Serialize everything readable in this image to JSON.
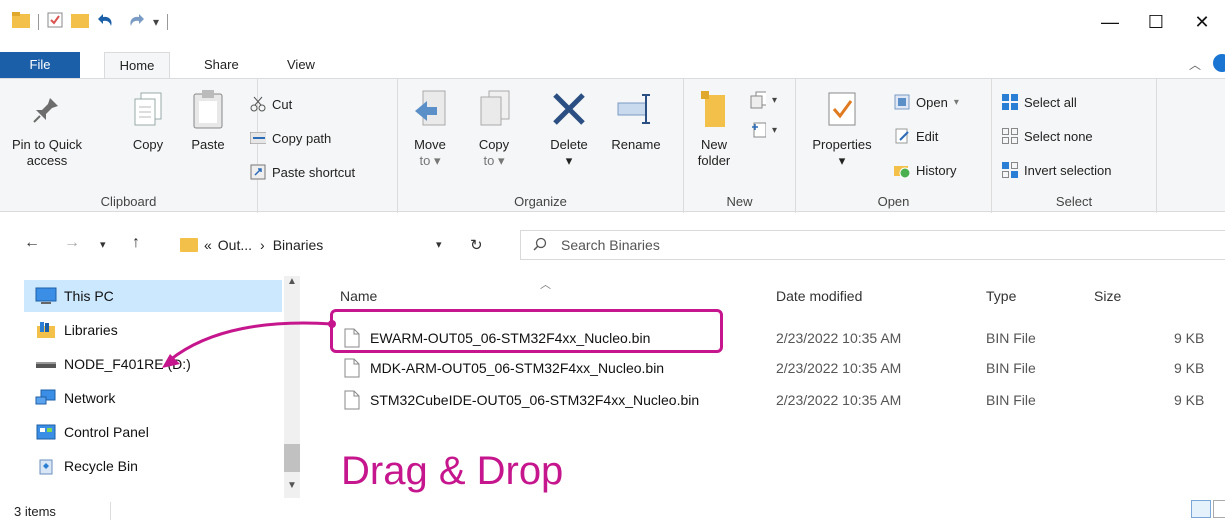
{
  "window": {
    "minimize": "—",
    "maximize": "☐",
    "close": "✕"
  },
  "tabs": {
    "file": "File",
    "home": "Home",
    "share": "Share",
    "view": "View"
  },
  "ribbon": {
    "clipboard": {
      "pin_line1": "Pin to Quick",
      "pin_line2": "access",
      "copy": "Copy",
      "paste": "Paste",
      "cut": "Cut",
      "copy_path": "Copy path",
      "paste_shortcut": "Paste shortcut",
      "label": "Clipboard"
    },
    "organize": {
      "move_line1": "Move",
      "move_line2": "to",
      "copy_line1": "Copy",
      "copy_line2": "to",
      "delete": "Delete",
      "rename": "Rename",
      "label": "Organize"
    },
    "new": {
      "new_folder_line1": "New",
      "new_folder_line2": "folder",
      "label": "New"
    },
    "open": {
      "properties": "Properties",
      "open": "Open",
      "edit": "Edit",
      "history": "History",
      "label": "Open"
    },
    "select": {
      "select_all": "Select all",
      "select_none": "Select none",
      "invert": "Invert selection",
      "label": "Select"
    }
  },
  "address": {
    "path_prefix": "«",
    "path_parent": "Out...",
    "path_sep": "›",
    "path_current": "Binaries",
    "search_placeholder": "Search Binaries"
  },
  "navpane": {
    "items": [
      {
        "label": "This PC"
      },
      {
        "label": "Libraries"
      },
      {
        "label": "NODE_F401RE (D:)"
      },
      {
        "label": "Network"
      },
      {
        "label": "Control Panel"
      },
      {
        "label": "Recycle Bin"
      }
    ]
  },
  "filelist": {
    "columns": {
      "name": "Name",
      "date": "Date modified",
      "type": "Type",
      "size": "Size"
    },
    "rows": [
      {
        "name": "EWARM-OUT05_06-STM32F4xx_Nucleo.bin",
        "date": "2/23/2022 10:35 AM",
        "type": "BIN File",
        "size": "9 KB"
      },
      {
        "name": "MDK-ARM-OUT05_06-STM32F4xx_Nucleo.bin",
        "date": "2/23/2022 10:35 AM",
        "type": "BIN File",
        "size": "9 KB"
      },
      {
        "name": "STM32CubeIDE-OUT05_06-STM32F4xx_Nucleo.bin",
        "date": "2/23/2022 10:35 AM",
        "type": "BIN File",
        "size": "9 KB"
      }
    ]
  },
  "annotation": {
    "text": "Drag & Drop",
    "color": "#c6168d"
  },
  "status": {
    "items": "3 items"
  },
  "colors": {
    "accent": "#1a5fa8",
    "selection": "#cce8ff",
    "folder": "#f3c04a"
  }
}
